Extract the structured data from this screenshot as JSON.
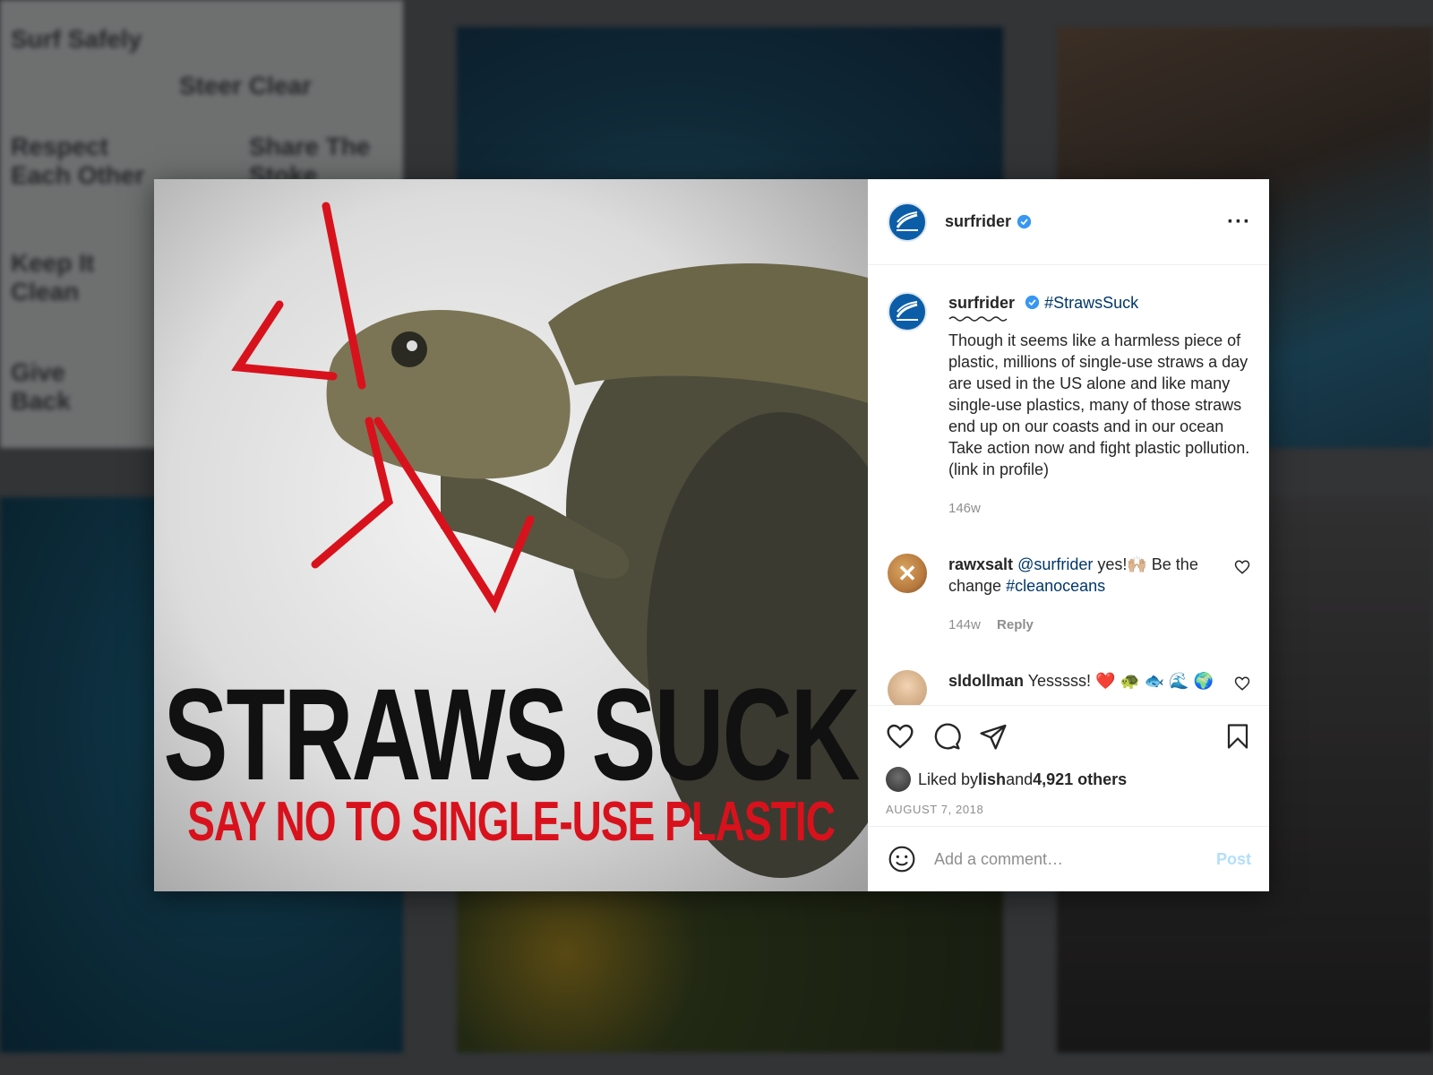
{
  "background": {
    "panel_words": [
      "Surf Safely",
      "Steer Clear",
      "Respect Each Other",
      "Share The Stoke",
      "Keep It Clean",
      "Give Back"
    ]
  },
  "post": {
    "image": {
      "headline": "STRAWS SUCK",
      "subheadline": "SAY NO TO SINGLE-USE PLASTIC",
      "headline_color": "#111111",
      "subheadline_color": "#d8121c"
    },
    "header": {
      "username": "surfrider",
      "verified": true,
      "more_label": "···"
    },
    "caption": {
      "username": "surfrider",
      "hashtag": "#StrawsSuck",
      "text": "Though it seems like a harmless piece of plastic, millions of single-use straws a day are used in the US alone and like many single-use plastics, many of those straws end up on our coasts and in our ocean\nTake action now and fight plastic pollution. (link in profile)",
      "age": "146w"
    },
    "comments": [
      {
        "username": "rawxsalt",
        "mention": "@surfrider",
        "text_before_tag": " yes!🙌🏼 Be the change ",
        "hashtag": "#cleanoceans",
        "age": "144w",
        "reply_label": "Reply"
      },
      {
        "username": "sldollman",
        "text": " Yesssss! ❤️ 🐢 🐟 🌊 🌍"
      }
    ],
    "likes": {
      "prefix": "Liked by ",
      "user": "lish",
      "middle": " and ",
      "count_text": "4,921 others"
    },
    "date": "AUGUST 7, 2018",
    "add_comment": {
      "placeholder": "Add a comment…",
      "post_label": "Post"
    },
    "colors": {
      "brand_blue": "#0c5da8",
      "link": "#00376b",
      "verified": "#3897f0",
      "post_disabled": "#b2dffc"
    }
  }
}
